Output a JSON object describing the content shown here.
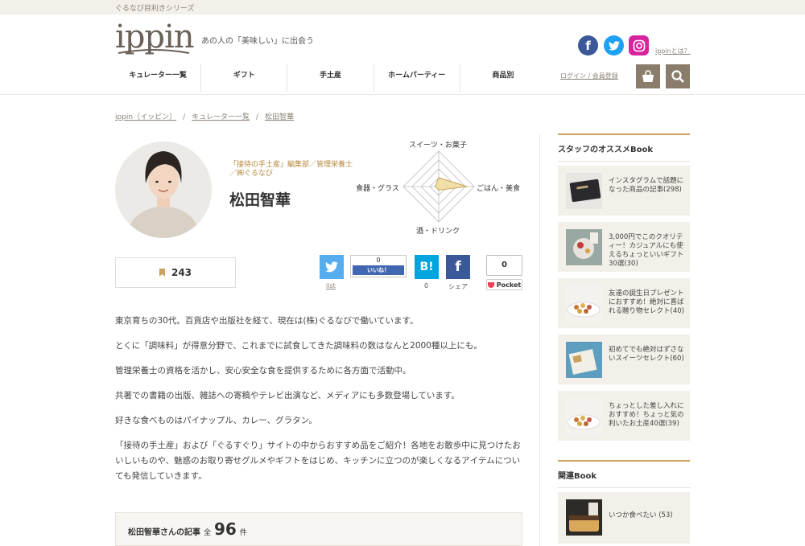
{
  "topbar": {
    "series_text": "ぐるなび目利きシリーズ"
  },
  "header": {
    "logo_text": "ippin",
    "tagline": "あの人の「美味しい」に出会う",
    "about_link": "ippinとは？",
    "login_link": "ログイン / 会員登録"
  },
  "nav": {
    "items": [
      "キュレーター一覧",
      "ギフト",
      "手土産",
      "ホームパーティー",
      "商品別"
    ]
  },
  "breadcrumb": [
    "ippin（イッピン）",
    "キュレーター一覧",
    "松田智華"
  ],
  "profile": {
    "role": "「接待の手土産」編集部／管理栄養士／㈱ぐるなび",
    "name": "松田智華",
    "bookmark_count": "243"
  },
  "radar": {
    "labels": {
      "top": "スイーツ・お菓子",
      "right": "ごはん・美食",
      "bottom": "酒・ドリンク",
      "left": "食器・グラス"
    },
    "values": {
      "top": 0.25,
      "right": 0.8,
      "bottom": 0.1,
      "left": 0.1
    }
  },
  "share": {
    "twitter_label": "list",
    "like_count": "0",
    "like_label": "いいね！",
    "hatena_label": "B!",
    "hatena_count": "0",
    "fb_label": "シェア",
    "pocket_count": "0",
    "pocket_label": "Pocket"
  },
  "bio": [
    "東京育ちの30代。百貨店や出版社を経て、現在は(株)ぐるなびで働いています。",
    "とくに「調味料」が得意分野で、これまでに試食してきた調味料の数はなんと2000種以上にも。",
    "管理栄養士の資格を活かし、安心安全な食を提供するために各方面で活動中。",
    "共著での書籍の出版、雑誌への寄稿やテレビ出演など、メディアにも多数登場しています。",
    "好きな食べものはパイナップル、カレー、グラタン。",
    "「接待の手土産」および「ぐるすぐり」サイトの中からおすすめ品をご紹介！各地をお散歩中に見つけたおいしいものや、魅惑のお取り寄せグルメやギフトをはじめ、キッチンに立つのが楽しくなるアイテムについても発信していきます。"
  ],
  "articles": {
    "label": "松田智華さんの記事",
    "prefix": "全",
    "count": "96",
    "suffix": "件"
  },
  "sidebar": {
    "staff_title": "スタッフのオススメBook",
    "staff_items": [
      "インスタグラムで話題になった商品の記事(298)",
      "3,000円でこのクオリティー！カジュアルにも使えるちょっといいギフト30選(30)",
      "友達の誕生日プレゼントにおすすめ！絶対に喜ばれる贈り物セレクト(40)",
      "初めてでも絶対はずさないスイーツセレクト(60)",
      "ちょっとした差し入れにおすすめ！ちょっと気の利いたお土産40選(39)"
    ],
    "related_title": "関連Book",
    "related_items": [
      "いつか食べたい (53)"
    ]
  },
  "colors": {
    "accent": "#c9a25b",
    "brown": "#8b7d6b",
    "beige": "#f3efe9"
  }
}
